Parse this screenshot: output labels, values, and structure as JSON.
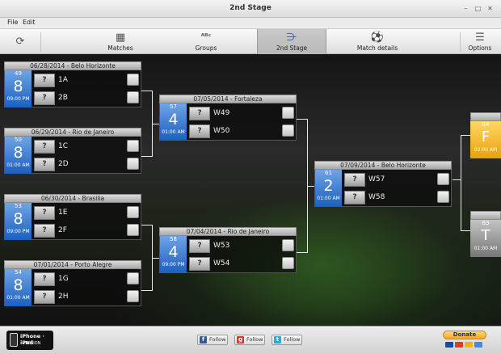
{
  "window": {
    "title": "2nd Stage"
  },
  "menu": [
    "File",
    "Edit"
  ],
  "toolbar": {
    "refresh_icon": "refresh-icon",
    "items": [
      {
        "label": "Matches",
        "icon": "calendar-icon"
      },
      {
        "label": "Groups",
        "icon": "abc-icon"
      },
      {
        "label": "2nd Stage",
        "icon": "bracket-icon"
      },
      {
        "label": "Match details",
        "icon": "soccer-ball-icon"
      },
      {
        "label": "Options",
        "icon": "list-icon"
      }
    ]
  },
  "matches": [
    {
      "header": "06/28/2014 - Belo Horizonte",
      "num": "49",
      "day": "8",
      "time": "09:00 PM",
      "teams": [
        "1A",
        "2B"
      ]
    },
    {
      "header": "06/29/2014 - Rio de Janeiro",
      "num": "50",
      "day": "8",
      "time": "01:00 AM",
      "teams": [
        "1C",
        "2D"
      ]
    },
    {
      "header": "06/30/2014 - Brasilia",
      "num": "53",
      "day": "8",
      "time": "09:00 PM",
      "teams": [
        "1E",
        "2F"
      ]
    },
    {
      "header": "07/01/2014 - Porto Alegre",
      "num": "54",
      "day": "8",
      "time": "01:00 AM",
      "teams": [
        "1G",
        "2H"
      ]
    },
    {
      "header": "07/05/2014 - Fortaleza",
      "num": "57",
      "day": "4",
      "time": "01:00 AM",
      "teams": [
        "W49",
        "W50"
      ]
    },
    {
      "header": "07/04/2014 - Rio de Janeiro",
      "num": "58",
      "day": "4",
      "time": "09:00 PM",
      "teams": [
        "W53",
        "W54"
      ]
    },
    {
      "header": "07/09/2014 - Belo Horizonte",
      "num": "61",
      "day": "2",
      "time": "01:00 AM",
      "teams": [
        "W57",
        "W58"
      ]
    }
  ],
  "unknown_mark": "?",
  "side": [
    {
      "num": "64",
      "letter": "F",
      "time": "02:00 AM",
      "color": "#f2b21b"
    },
    {
      "num": "63",
      "letter": "T",
      "time": "01:00 AM",
      "color": "#8f8f8f"
    }
  ],
  "footer": {
    "device_line1": "iPhone · iPad",
    "device_line2": "VERSION",
    "social": [
      {
        "label": "Follow",
        "icon": "facebook-icon",
        "color": "#3b5998",
        "glyph": "f"
      },
      {
        "label": "Follow",
        "icon": "google-plus-icon",
        "color": "#d23b2f",
        "glyph": "g"
      },
      {
        "label": "Follow",
        "icon": "twitter-icon",
        "color": "#2aa9e0",
        "glyph": "t"
      }
    ],
    "donate": "Donate"
  },
  "colors": {
    "match_blue": "#1b5fc0",
    "final_gold": "#f2b21b"
  }
}
